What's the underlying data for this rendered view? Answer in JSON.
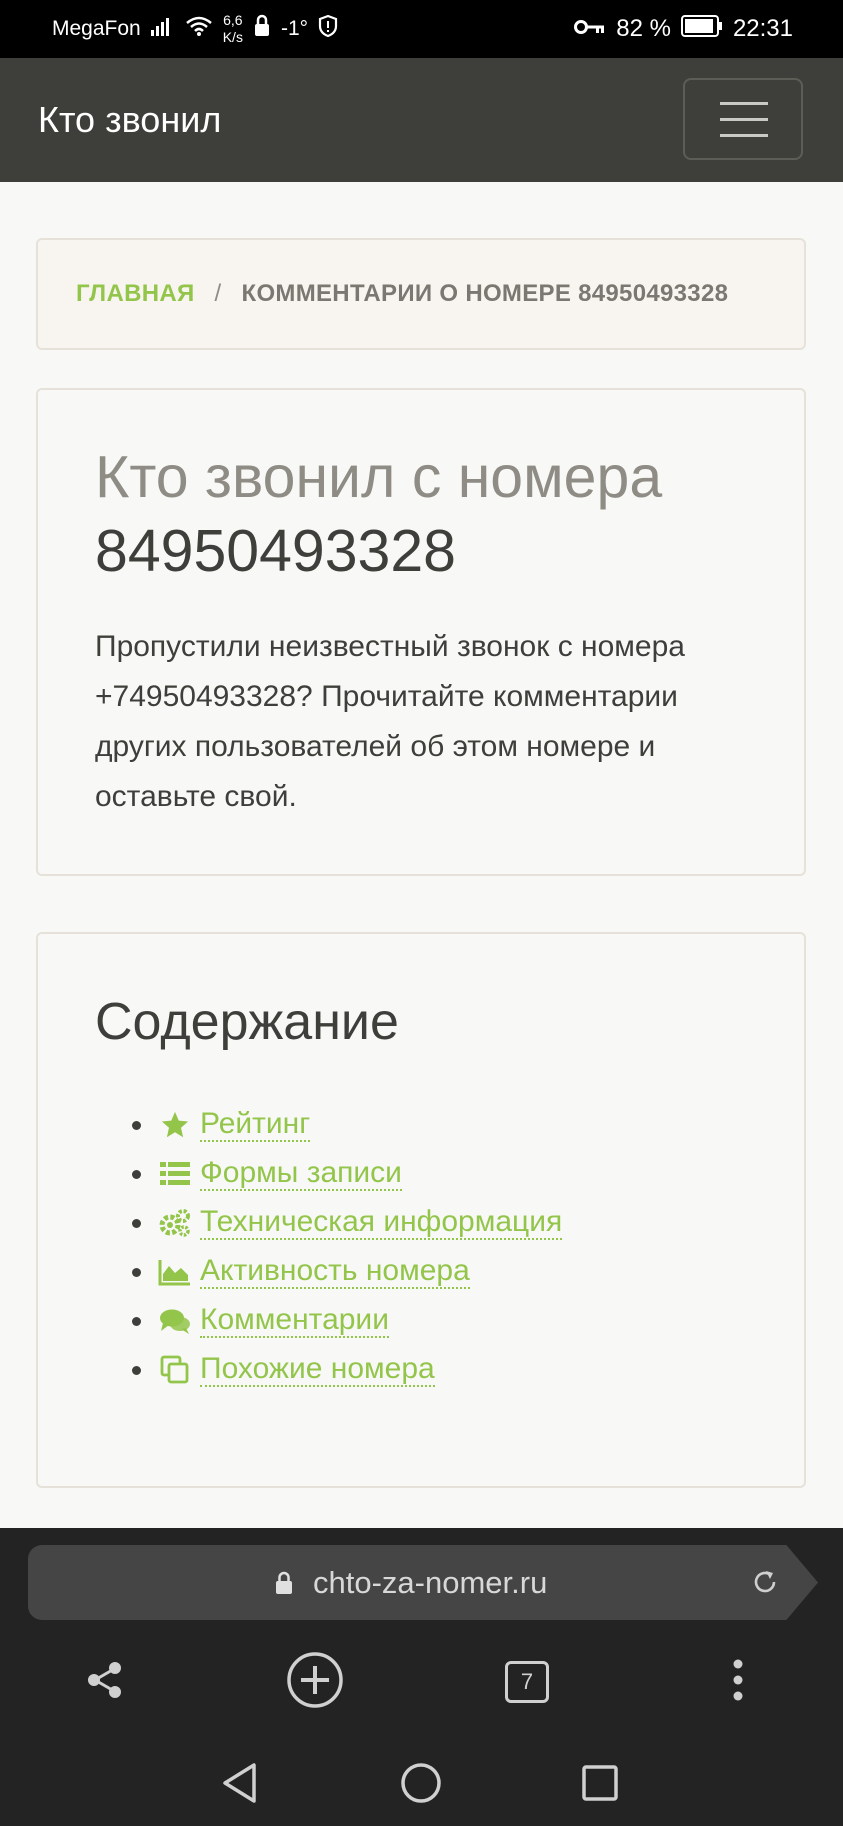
{
  "status_bar": {
    "carrier": "MegaFon",
    "speed_value": "6,6",
    "speed_unit": "K/s",
    "temperature": "-1°",
    "battery_percent": "82 %",
    "time": "22:31"
  },
  "navbar": {
    "brand": "Кто звонил"
  },
  "breadcrumb": {
    "home": "ГЛАВНАЯ",
    "separator": "/",
    "current": "КОММЕНТАРИИ О НОМЕРЕ 84950493328"
  },
  "hero": {
    "title_prefix": "Кто звонил с номера",
    "title_number": "84950493328",
    "description": "Пропустили неизвестный звонок с номера +74950493328? Прочитайте комментарии других пользователей об этом номере и оставьте свой."
  },
  "toc": {
    "heading": "Содержание",
    "items": [
      {
        "label": "Рейтинг",
        "icon": "star-icon"
      },
      {
        "label": "Формы записи",
        "icon": "list-icon"
      },
      {
        "label": "Техническая информация",
        "icon": "gears-icon"
      },
      {
        "label": "Активность номера",
        "icon": "area-chart-icon"
      },
      {
        "label": "Комментарии",
        "icon": "comments-icon"
      },
      {
        "label": "Похожие номера",
        "icon": "copy-icon"
      }
    ]
  },
  "browser": {
    "url": "chto-za-nomer.ru",
    "tab_count": "7"
  },
  "colors": {
    "accent": "#93c54b",
    "navbar_bg": "#3e3f3a",
    "text_dark": "#3e3f3a",
    "text_muted": "#8e8c84"
  }
}
